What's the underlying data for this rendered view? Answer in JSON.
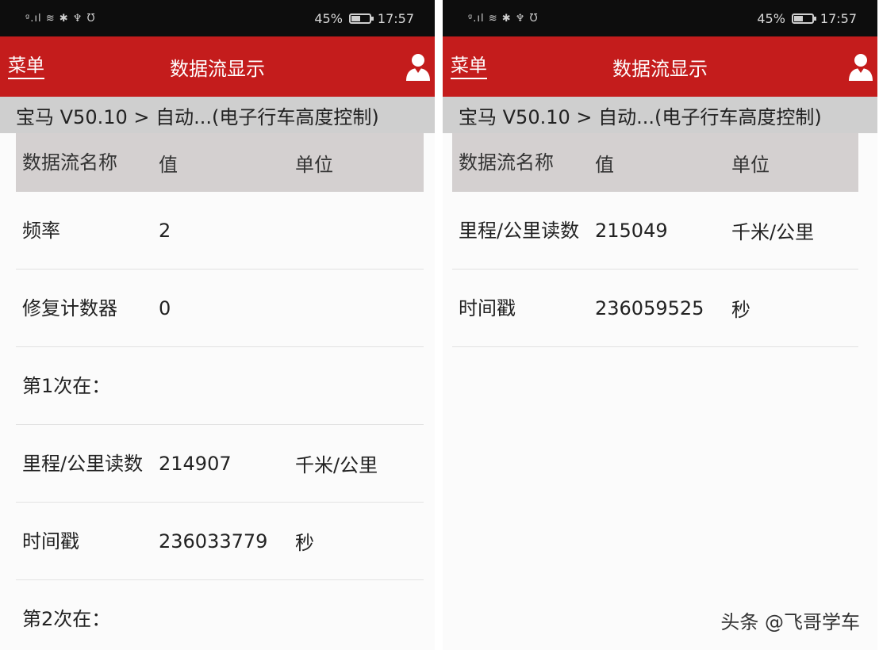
{
  "left": {
    "status": {
      "signal": "ᵍ.ıl ≋ ✱ ♆ Ʊ",
      "battery": "45%",
      "battery_level": 0.45,
      "time": "17:57"
    },
    "appbar": {
      "menu_label": "菜单",
      "title": "数据流显示",
      "user_icon": "user-icon"
    },
    "breadcrumb": "宝马 V50.10 > 自动...(电子行车高度控制)",
    "table": {
      "headers": [
        "数据流名称",
        "值",
        "单位"
      ],
      "rows": [
        {
          "name": "频率",
          "value": "2",
          "unit": ""
        },
        {
          "name": "修复计数器",
          "value": "0",
          "unit": ""
        },
        {
          "name": "第1次在：",
          "value": "",
          "unit": ""
        },
        {
          "name": "里程/公里读数",
          "value": "214907",
          "unit": "千米/公里"
        },
        {
          "name": "时间戳",
          "value": "236033779",
          "unit": "秒"
        },
        {
          "name": "第2次在：",
          "value": "",
          "unit": ""
        }
      ]
    }
  },
  "right": {
    "status": {
      "signal": "ᵍ.ıl ≋ ✱ ♆ Ʊ",
      "battery": "45%",
      "battery_level": 0.45,
      "time": "17:57"
    },
    "appbar": {
      "menu_label": "菜单",
      "title": "数据流显示",
      "user_icon": "user-icon"
    },
    "breadcrumb": "宝马 V50.10 > 自动...(电子行车高度控制)",
    "table": {
      "headers": [
        "数据流名称",
        "值",
        "单位"
      ],
      "rows": [
        {
          "name": "里程/公里读数",
          "value": "215049",
          "unit": "千米/公里"
        },
        {
          "name": "时间戳",
          "value": "236059525",
          "unit": "秒"
        }
      ]
    }
  },
  "watermark": "头条 @飞哥学车",
  "colors": {
    "appbar": "#c41c1c",
    "breadcrumb": "#cfcfcf",
    "table_header": "#d4d0d0"
  }
}
